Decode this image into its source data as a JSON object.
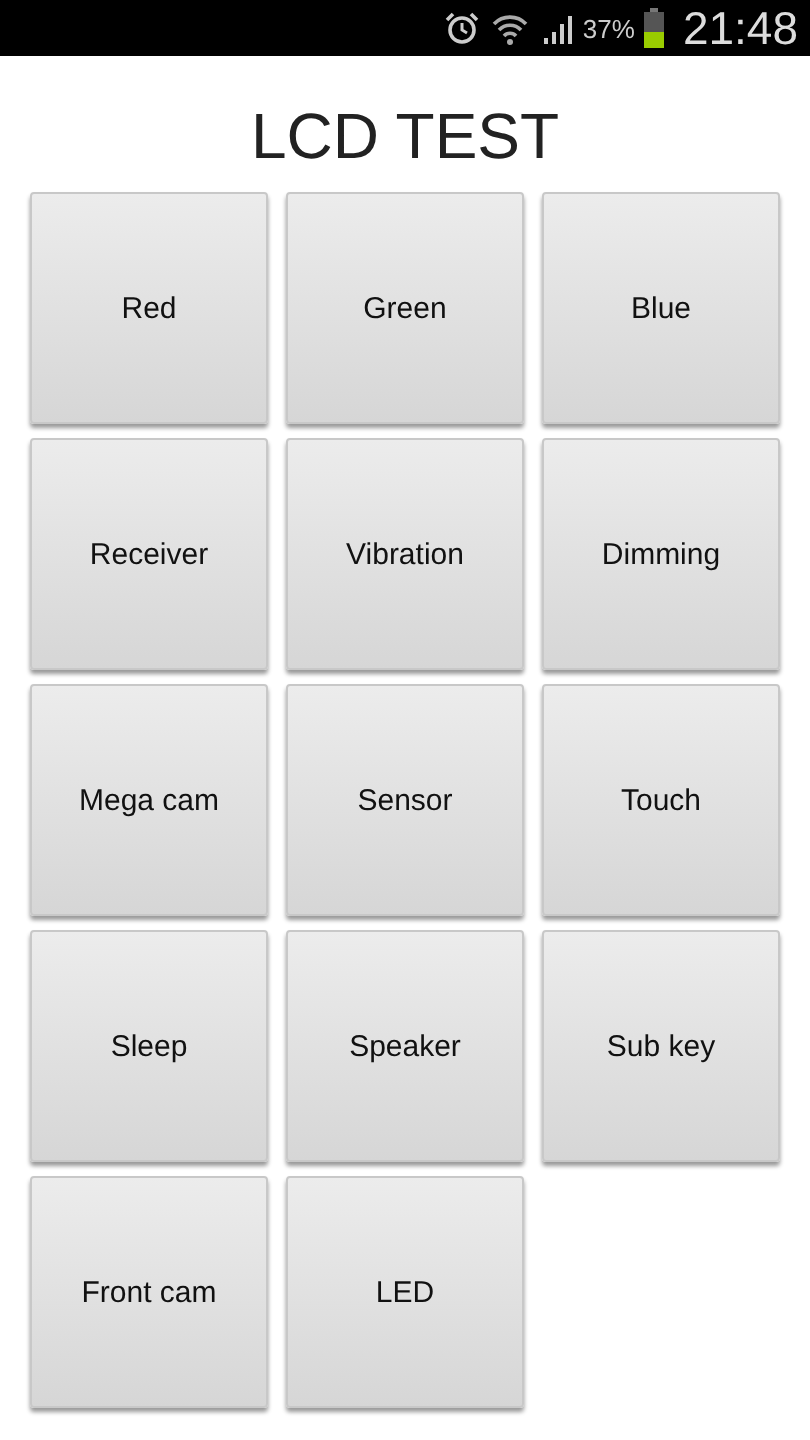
{
  "status_bar": {
    "battery_text": "37%",
    "time": "21:48"
  },
  "title": "LCD TEST",
  "buttons": [
    "Red",
    "Green",
    "Blue",
    "Receiver",
    "Vibration",
    "Dimming",
    "Mega cam",
    "Sensor",
    "Touch",
    "Sleep",
    "Speaker",
    "Sub key",
    "Front cam",
    "LED"
  ]
}
